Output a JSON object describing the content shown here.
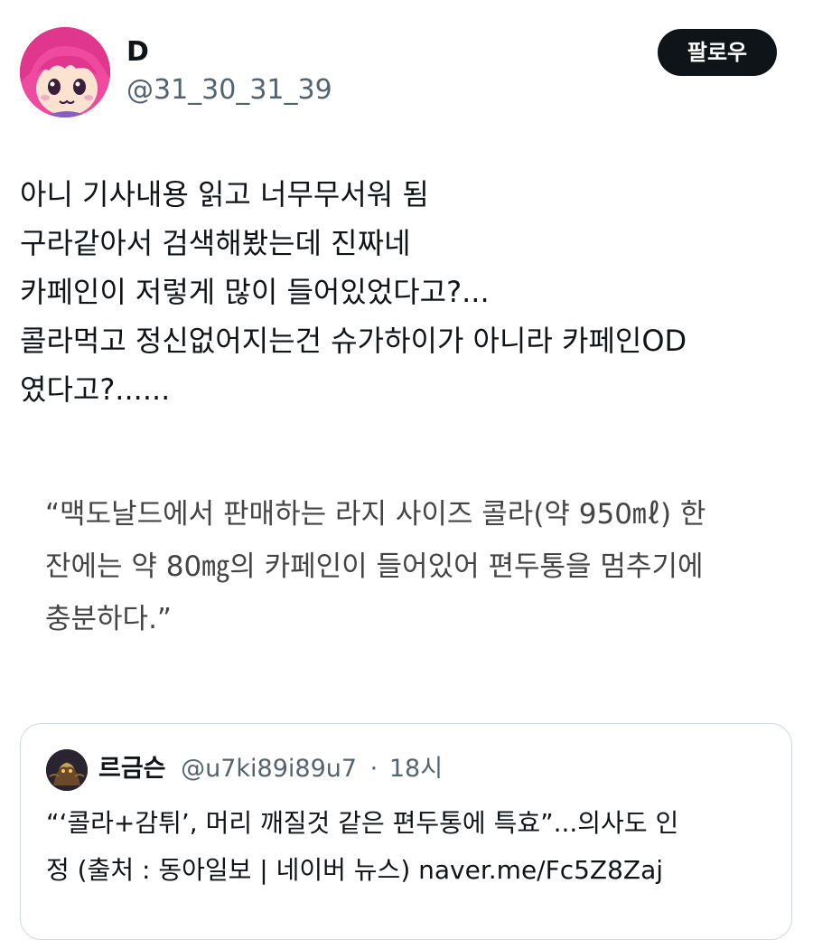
{
  "author": {
    "display_name": "D",
    "handle": "@31_30_31_39",
    "avatar_icon": "anime-girl-avatar-icon"
  },
  "follow_button": {
    "label": "팔로우"
  },
  "tweet": {
    "lines": [
      "아니 기사내용 읽고 너무무서워 됨",
      "구라같아서 검색해봤는데 진짜네",
      "카페인이 저렇게 많이 들어있었다고?...",
      "콜라먹고 정신없어지는건 슈가하이가 아니라 카페인OD",
      "였다고?......"
    ]
  },
  "quote_excerpt": {
    "lines": [
      "“맥도날드에서 판매하는 라지 사이즈 콜라(약 950㎖) 한",
      "잔에는 약 80㎎의 카페인이 들어있어 편두통을 멈추기에",
      "충분하다.”"
    ]
  },
  "quoted_tweet": {
    "display_name": "르금슨",
    "handle": "@u7ki89i89u7",
    "separator": "·",
    "time": "18시",
    "avatar_icon": "armored-figure-avatar-icon",
    "lines": [
      "“‘콜라+감튀’, 머리 깨질것 같은 편두통에 특효”...의사도 인",
      "정 (출처 : 동아일보 | 네이버 뉴스) naver.me/Fc5Z8Zaj"
    ]
  },
  "colors": {
    "text_primary": "#0f1419",
    "text_secondary": "#536471",
    "quote_text": "#444444",
    "button_bg": "#0f1419",
    "border": "#cfd9de",
    "avatar_pink": "#f05aa8"
  }
}
